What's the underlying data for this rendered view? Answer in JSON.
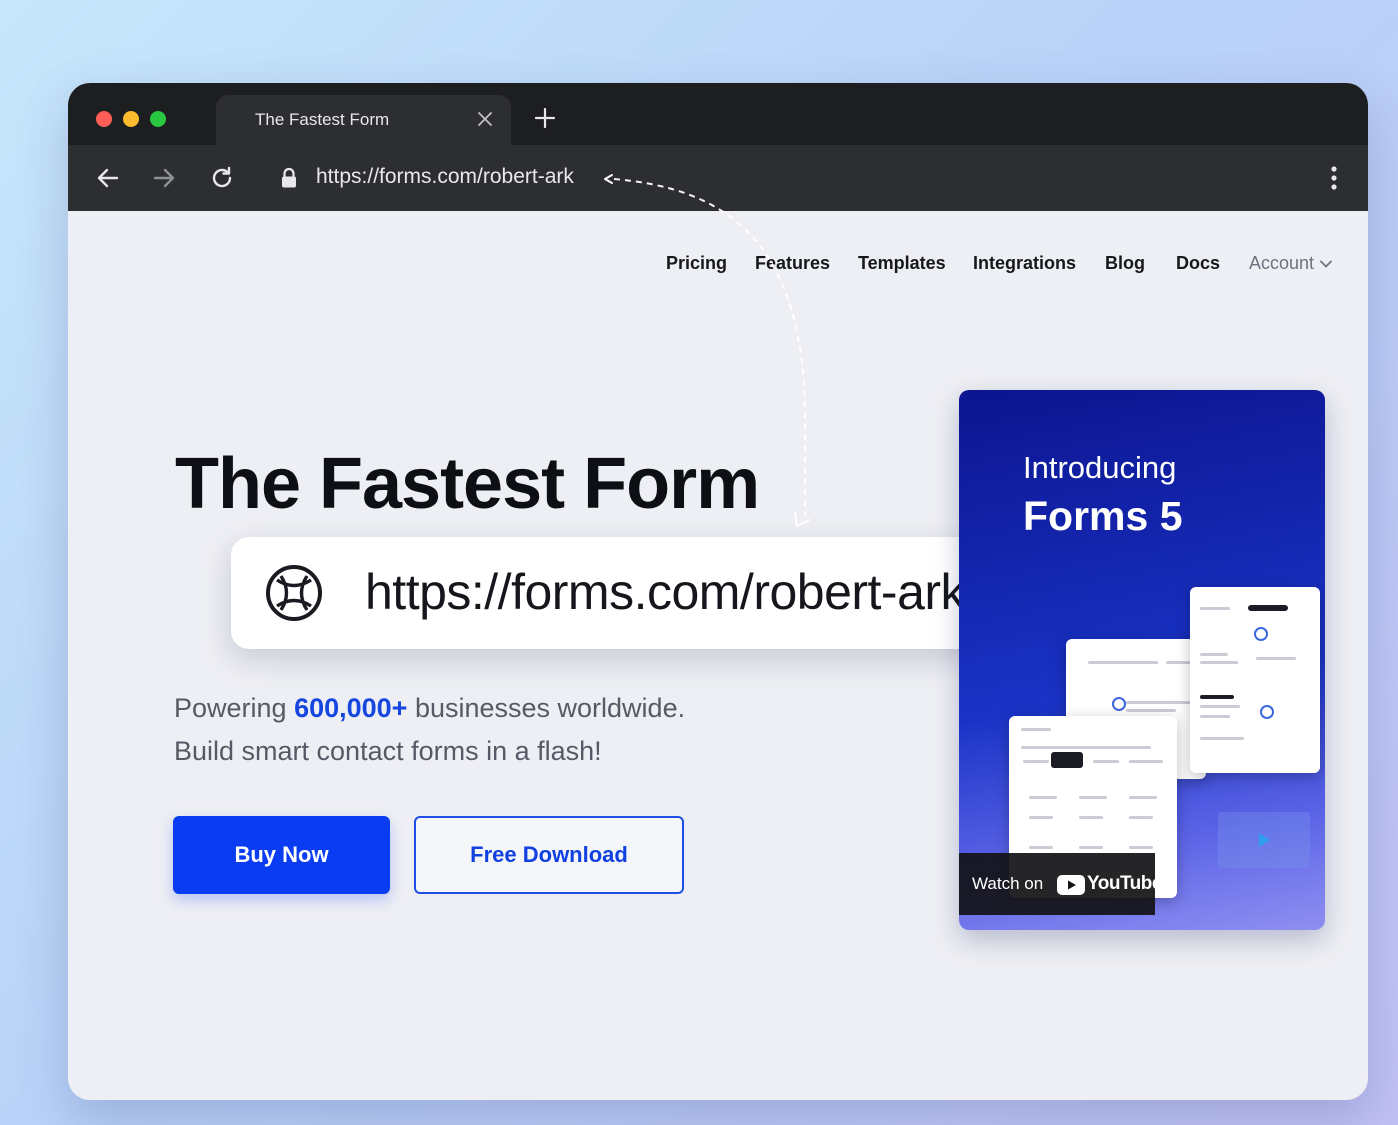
{
  "browser": {
    "tab_title": "The Fastest Form",
    "address": "https://forms.com/robert-ark"
  },
  "nav": {
    "items": [
      "Pricing",
      "Features",
      "Templates",
      "Integrations",
      "Blog",
      "Docs"
    ],
    "account": "Account"
  },
  "hero": {
    "title": "The Fastest Form",
    "url_callout": "https://forms.com/robert-ark",
    "tagline_pre": "Powering ",
    "tagline_highlight": "600,000+",
    "tagline_post": " businesses worldwide.",
    "tagline_line2": "Build smart contact forms in a flash!",
    "primary_button": "Buy Now",
    "secondary_button": "Free Download"
  },
  "promo": {
    "intro": "Introducing",
    "name": "Forms 5",
    "watch_on": "Watch on",
    "youtube": "YouTube"
  },
  "colors": {
    "accent": "#0a3df2",
    "highlight": "#1646e0",
    "browser_dark": "#1d1e20",
    "promo_blue": "#1a33c6"
  },
  "icons": {
    "back": "arrow-left-icon",
    "forward": "arrow-right-icon",
    "reload": "reload-icon",
    "lock": "lock-icon",
    "menu": "kebab-menu-icon",
    "globe": "globe-icon",
    "play": "play-icon"
  }
}
